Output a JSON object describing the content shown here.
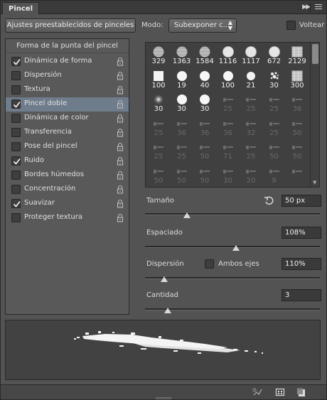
{
  "panel": {
    "tab_label": "Pincel"
  },
  "toolbar": {
    "preset_label": "Ajustes preestablecidos de pinceles",
    "mode_label": "Modo:",
    "mode_value": "Subexponer c...",
    "flip_label": "Voltear"
  },
  "options": {
    "header": "Forma de la punta del pincel",
    "items": [
      {
        "label": "Dinámica de forma",
        "checked": true,
        "selected": false,
        "lock": true
      },
      {
        "label": "Dispersión",
        "checked": false,
        "selected": false,
        "lock": true
      },
      {
        "label": "Textura",
        "checked": false,
        "selected": false,
        "lock": true
      },
      {
        "label": "Pincel doble",
        "checked": true,
        "selected": true,
        "lock": true
      },
      {
        "label": "Dinámica de color",
        "checked": false,
        "selected": false,
        "lock": true
      },
      {
        "label": "Transferencia",
        "checked": false,
        "selected": false,
        "lock": true
      },
      {
        "label": "Pose del pincel",
        "checked": false,
        "selected": false,
        "lock": true
      },
      {
        "label": "Ruido",
        "checked": true,
        "selected": false,
        "lock": true
      },
      {
        "label": "Bordes húmedos",
        "checked": false,
        "selected": false,
        "lock": true
      },
      {
        "label": "Concentración",
        "checked": false,
        "selected": false,
        "lock": true
      },
      {
        "label": "Suavizar",
        "checked": true,
        "selected": false,
        "lock": true
      },
      {
        "label": "Proteger textura",
        "checked": false,
        "selected": false,
        "lock": true
      }
    ]
  },
  "brushes": {
    "rows": [
      [
        {
          "size": "329",
          "icon": "striped-circle",
          "dim": false
        },
        {
          "size": "1363",
          "icon": "striped-circle",
          "dim": false
        },
        {
          "size": "1584",
          "icon": "striped-circle",
          "dim": false
        },
        {
          "size": "1116",
          "icon": "soft-circle",
          "dim": false
        },
        {
          "size": "1117",
          "icon": "soft-circle",
          "dim": false
        },
        {
          "size": "672",
          "icon": "soft-circle",
          "dim": false
        },
        {
          "size": "2129",
          "icon": "texture-square",
          "dim": false
        }
      ],
      [
        {
          "size": "100",
          "icon": "square",
          "dim": false
        },
        {
          "size": "19",
          "icon": "hard-circle",
          "dim": false
        },
        {
          "size": "40",
          "icon": "hard-circle",
          "dim": false
        },
        {
          "size": "100",
          "icon": "hard-circle",
          "dim": false
        },
        {
          "size": "21",
          "icon": "dot",
          "dim": false
        },
        {
          "size": "30",
          "icon": "splatter",
          "dim": false
        },
        {
          "size": "300",
          "icon": "texture-square",
          "dim": false
        }
      ],
      [
        {
          "size": "30",
          "icon": "fuzzy-circle",
          "dim": false
        },
        {
          "size": "30",
          "icon": "hard-circle",
          "dim": false
        },
        {
          "size": "30",
          "icon": "hard-circle",
          "dim": false
        },
        {
          "size": "25",
          "icon": "stroke",
          "dim": true
        },
        {
          "size": "25",
          "icon": "stroke",
          "dim": true
        },
        {
          "size": "25",
          "icon": "stroke",
          "dim": true
        },
        {
          "size": "36",
          "icon": "stroke",
          "dim": true
        }
      ],
      [
        {
          "size": "25",
          "icon": "stroke",
          "dim": true
        },
        {
          "size": "36",
          "icon": "stroke",
          "dim": true
        },
        {
          "size": "36",
          "icon": "stroke",
          "dim": true
        },
        {
          "size": "36",
          "icon": "stroke",
          "dim": true
        },
        {
          "size": "32",
          "icon": "stroke",
          "dim": true
        },
        {
          "size": "25",
          "icon": "stroke",
          "dim": true
        },
        {
          "size": "50",
          "icon": "stroke",
          "dim": true
        }
      ],
      [
        {
          "size": "25",
          "icon": "stroke",
          "dim": true
        },
        {
          "size": "25",
          "icon": "stroke",
          "dim": true
        },
        {
          "size": "50",
          "icon": "stroke",
          "dim": true
        },
        {
          "size": "71",
          "icon": "stroke",
          "dim": true
        },
        {
          "size": "25",
          "icon": "stroke",
          "dim": true
        },
        {
          "size": "50",
          "icon": "stroke",
          "dim": true
        },
        {
          "size": "50",
          "icon": "stroke",
          "dim": true
        }
      ],
      [
        {
          "size": "50",
          "icon": "stroke",
          "dim": true
        },
        {
          "size": "50",
          "icon": "stroke",
          "dim": true
        },
        {
          "size": "50",
          "icon": "stroke",
          "dim": true
        },
        {
          "size": "30",
          "icon": "stroke",
          "dim": true
        },
        {
          "size": "20",
          "icon": "stroke",
          "dim": true
        },
        {
          "size": "9",
          "icon": "stroke",
          "dim": true
        },
        {
          "size": "",
          "icon": "stroke",
          "dim": true
        }
      ]
    ]
  },
  "controls": {
    "size_label": "Tamaño",
    "size_value": "50 px",
    "size_pos": 0.24,
    "spacing_label": "Espaciado",
    "spacing_value": "108%",
    "spacing_pos": 0.52,
    "scatter_label": "Dispersión",
    "both_axes_label": "Ambos ejes",
    "scatter_value": "110%",
    "scatter_pos": 0.11,
    "count_label": "Cantidad",
    "count_value": "3",
    "count_pos": 0.13
  }
}
